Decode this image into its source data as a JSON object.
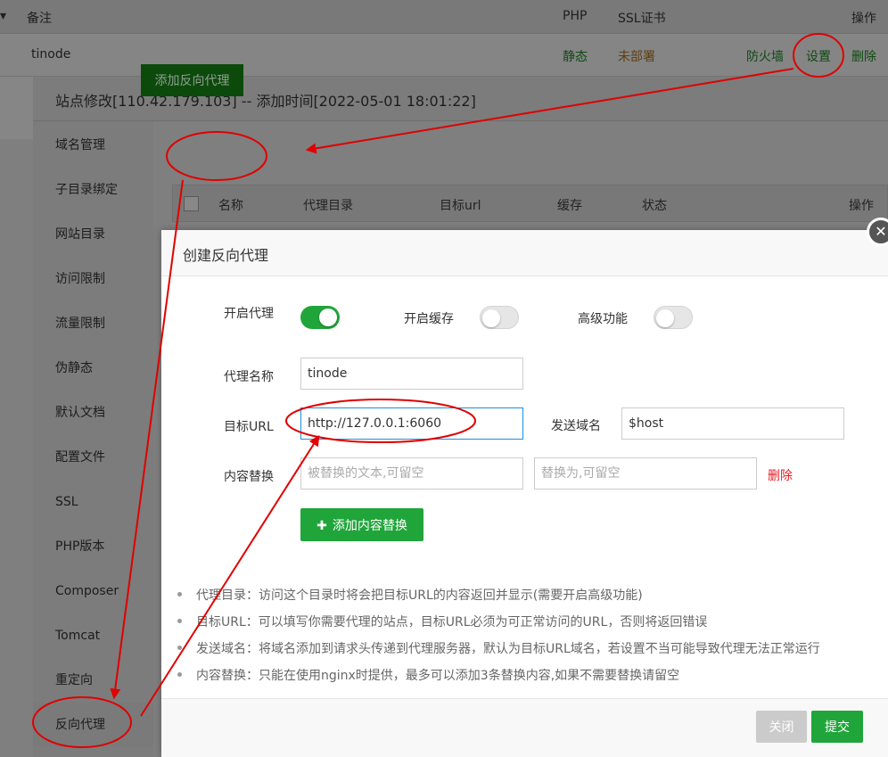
{
  "site_list": {
    "headers": {
      "remark": "备注",
      "php": "PHP",
      "ssl": "SSL证书",
      "ops": "操作"
    },
    "row": {
      "name": "tinode",
      "php": "静态",
      "ssl": "未部署",
      "firewall": "防火墙",
      "settings": "设置",
      "delete": "删除"
    }
  },
  "outer_dialog": {
    "title": "站点修改[110.42.179.103] -- 添加时间[2022-05-01 18:01:22]",
    "menu": [
      "域名管理",
      "子目录绑定",
      "网站目录",
      "访问限制",
      "流量限制",
      "伪静态",
      "默认文档",
      "配置文件",
      "SSL",
      "PHP版本",
      "Composer",
      "Tomcat",
      "重定向",
      "反向代理"
    ],
    "active_menu": "反向代理",
    "add_proxy_button": "添加反向代理",
    "table_headers": [
      "名称",
      "代理目录",
      "目标url",
      "缓存",
      "状态",
      "操作"
    ]
  },
  "proxy_dialog": {
    "title": "创建反向代理",
    "enable_proxy_label": "开启代理",
    "enable_proxy": true,
    "enable_cache_label": "开启缓存",
    "enable_cache": false,
    "advanced_label": "高级功能",
    "advanced": false,
    "name_label": "代理名称",
    "name_value": "tinode",
    "target_url_label": "目标URL",
    "target_url_value": "http://127.0.0.1:6060",
    "send_domain_label": "发送域名",
    "send_domain_value": "$host",
    "replace_label": "内容替换",
    "replace_from_placeholder": "被替换的文本,可留空",
    "replace_to_placeholder": "替换为,可留空",
    "replace_delete": "删除",
    "add_replace_button": "添加内容替换",
    "help": [
      "代理目录：访问这个目录时将会把目标URL的内容返回并显示(需要开启高级功能)",
      "目标URL：可以填写你需要代理的站点，目标URL必须为可正常访问的URL，否则将返回错误",
      "发送域名：将域名添加到请求头传递到代理服务器，默认为目标URL域名，若设置不当可能导致代理无法正常运行",
      "内容替换：只能在使用nginx时提供，最多可以添加3条替换内容,如果不需要替换请留空"
    ],
    "close_button": "关闭",
    "submit_button": "提交"
  },
  "colors": {
    "green": "#20a53a",
    "annotation_red": "#e00000",
    "focus_blue": "#1a8fe0"
  }
}
